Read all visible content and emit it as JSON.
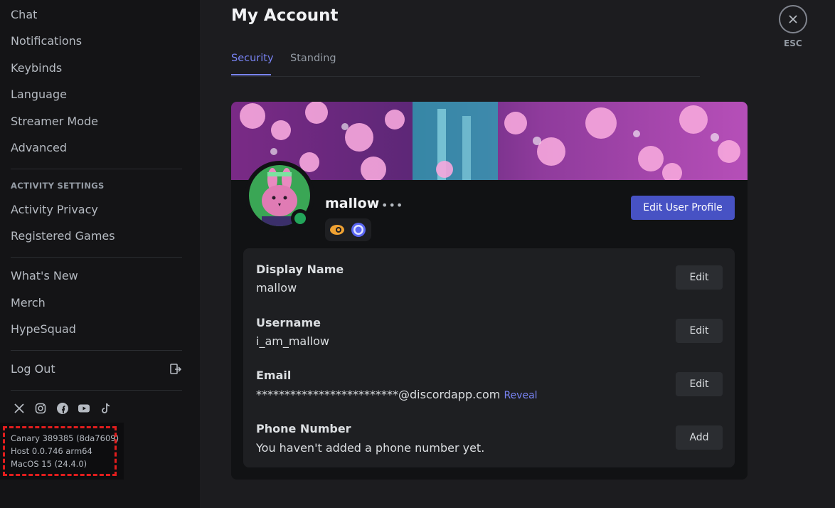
{
  "sidebar": {
    "items_top": [
      "Chat",
      "Notifications",
      "Keybinds",
      "Language",
      "Streamer Mode",
      "Advanced"
    ],
    "activity_header": "ACTIVITY SETTINGS",
    "activity_items": [
      "Activity Privacy",
      "Registered Games"
    ],
    "misc_items": [
      "What's New",
      "Merch",
      "HypeSquad"
    ],
    "logout": "Log Out",
    "socials": [
      "x-icon",
      "instagram-icon",
      "facebook-icon",
      "youtube-icon",
      "tiktok-icon"
    ],
    "version": [
      "Canary 389385 (8da7609)",
      "Host 0.0.746 arm64",
      "MacOS 15 (24.4.0)"
    ]
  },
  "header": {
    "title": "My Account",
    "tabs": [
      "Security",
      "Standing"
    ],
    "esc_label": "ESC"
  },
  "profile": {
    "username": "mallow",
    "edit_profile_label": "Edit User Profile",
    "status": "online",
    "badges": [
      "hypesquad-icon",
      "quest-icon"
    ]
  },
  "fields": [
    {
      "label": "Display Name",
      "value": "mallow",
      "button": "Edit"
    },
    {
      "label": "Username",
      "value": "i_am_mallow",
      "button": "Edit"
    },
    {
      "label": "Email",
      "value": "*************************@discordapp.com",
      "extra": "Reveal",
      "button": "Edit"
    },
    {
      "label": "Phone Number",
      "value": "You haven't added a phone number yet.",
      "button": "Add"
    }
  ],
  "colors": {
    "accent": "#7984f5",
    "button_primary": "#4752c4",
    "status_online": "#23a55a",
    "highlight_box": "#e11d1d"
  }
}
